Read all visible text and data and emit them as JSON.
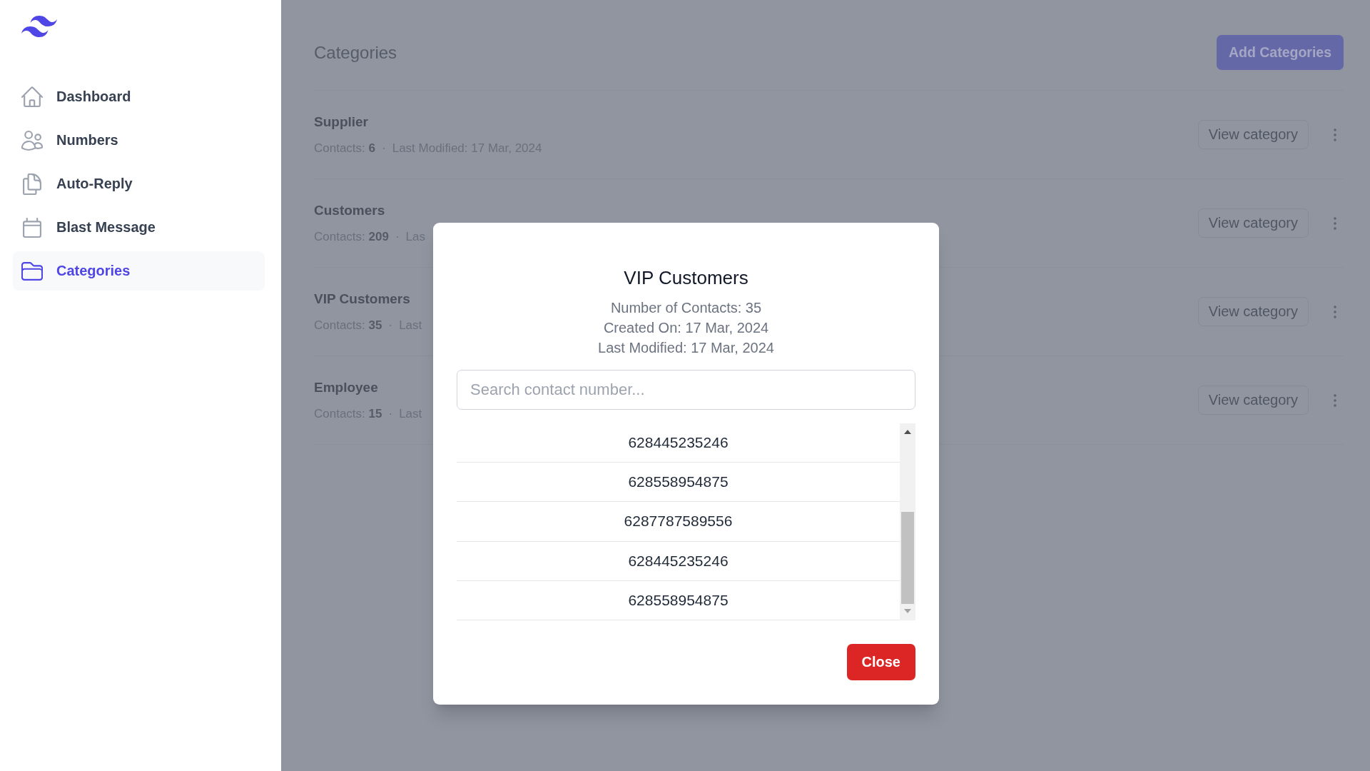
{
  "sidebar": {
    "items": [
      {
        "label": "Dashboard",
        "selected": false
      },
      {
        "label": "Numbers",
        "selected": false
      },
      {
        "label": "Auto-Reply",
        "selected": false
      },
      {
        "label": "Blast Message",
        "selected": false
      },
      {
        "label": "Categories",
        "selected": true
      }
    ]
  },
  "page": {
    "title": "Categories",
    "add_button": "Add Categories"
  },
  "categories": [
    {
      "name": "Supplier",
      "contacts": "Contacts: **6**",
      "separator": "·",
      "modified": "Last Modified: 17 Mar, 2024",
      "view_button": "View category"
    },
    {
      "name": "Customers",
      "contacts": "Contacts: **209**",
      "separator": "·",
      "modified": "Las",
      "view_button": "View category"
    },
    {
      "name": "VIP Customers",
      "contacts": "Contacts: **35**",
      "separator": "·",
      "modified": "Last",
      "view_button": "View category"
    },
    {
      "name": "Employee",
      "contacts": "Contacts: **15**",
      "separator": "·",
      "modified": "Last",
      "view_button": "View category"
    }
  ],
  "modal": {
    "title": "VIP Customers",
    "details": [
      "Number of Contacts: 35",
      "Created On: 17 Mar, 2024",
      "Last Modified: 17 Mar, 2024"
    ],
    "search": {
      "placeholder": "Search contact number..."
    },
    "contacts": [
      "628445235246",
      "628558954875",
      "6287787589556",
      "628445235246",
      "628558954875"
    ],
    "close_button": "Close"
  }
}
